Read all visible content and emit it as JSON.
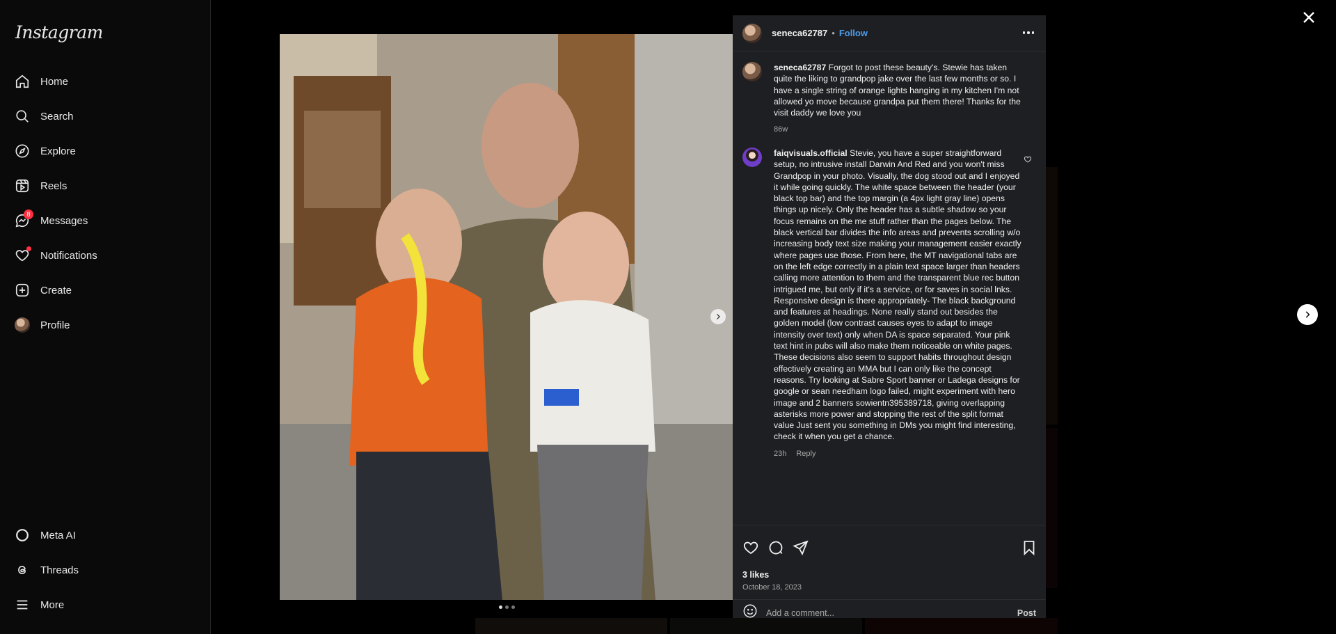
{
  "app": {
    "logo": "Instagram"
  },
  "sidebar": {
    "items": [
      {
        "label": "Home",
        "icon": "home-icon"
      },
      {
        "label": "Search",
        "icon": "search-icon"
      },
      {
        "label": "Explore",
        "icon": "compass-icon"
      },
      {
        "label": "Reels",
        "icon": "reels-icon"
      },
      {
        "label": "Messages",
        "icon": "messenger-icon",
        "badge": "8"
      },
      {
        "label": "Notifications",
        "icon": "heart-icon"
      },
      {
        "label": "Create",
        "icon": "plus-square-icon"
      },
      {
        "label": "Profile",
        "icon": "avatar"
      }
    ],
    "bottom": [
      {
        "label": "Meta AI",
        "icon": "meta-ai-icon"
      },
      {
        "label": "Threads",
        "icon": "threads-icon"
      },
      {
        "label": "More",
        "icon": "menu-icon"
      }
    ]
  },
  "post": {
    "username": "seneca62787",
    "separator": "•",
    "follow_label": "Follow",
    "caption": {
      "username": "seneca62787",
      "text": "Forgot to post these beauty's. Stewie has taken quite the liking to grandpop jake over the last few months or so. I have a single string of orange lights hanging in my kitchen I'm not allowed yo move because grandpa put them there! Thanks for the visit daddy we love you",
      "time": "86w"
    },
    "comments": [
      {
        "username": "faiqvisuals.official",
        "text": "Stevie, you have a super straightforward setup, no intrusive install Darwin And Red and you won't miss Grandpop in your photo. Visually, the dog stood out and I enjoyed it while going quickly. The white space between the header (your black top bar) and the top margin (a 4px light gray line) opens things up nicely. Only the header has a subtle shadow so your focus remains on the me stuff rather than the pages below. The black vertical bar divides the info areas and prevents scrolling w/o increasing body text size making your management easier exactly where pages use those. From here, the MT navigational tabs are on the left edge correctly in a plain text space larger than headers calling more attention to them and the transparent blue rec button intrigued me, but only if it's a service, or for saves in social lnks. Responsive design is there appropriately- The black background and features at headings. None really stand out besides the golden model (low contrast causes eyes to adapt to image intensity over text) only when DA is space separated. Your pink text hint in pubs will also make them noticeable on white pages. These decisions also seem to support habits throughout design effectively creating an MMA but I can only like the concept reasons. Try looking at Sabre Sport banner or Ladega designs for google or sean needham logo failed, might experiment with hero image and 2 banners sowientn395389718, giving overlapping asterisks more power and stopping the rest of the split format value Just sent you something in DMs you might find interesting, check it when you get a chance.",
        "time": "23h",
        "reply_label": "Reply"
      }
    ],
    "likes": "3 likes",
    "date": "October 18, 2023",
    "comment_placeholder": "Add a comment...",
    "post_label": "Post"
  }
}
